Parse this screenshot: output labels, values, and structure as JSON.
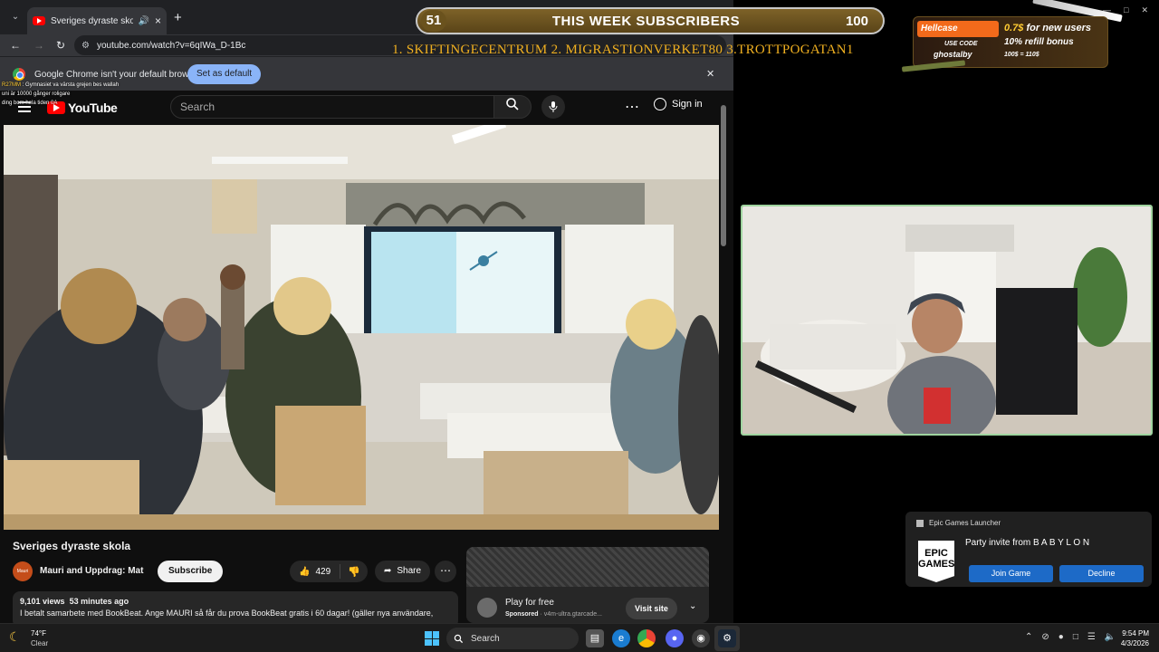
{
  "browser": {
    "tab_title": "Sveriges dyraste skola - YouTube",
    "url": "youtube.com/watch?v=6qIWa_D-1Bc",
    "infobar_message": "Google Chrome isn't your default browser",
    "set_default_label": "Set as default"
  },
  "chat": [
    {
      "user": "R27MM",
      "msg": "Gymnasiet va värsta grejen bes wallah"
    },
    {
      "user": "",
      "msg": "uni är 10000 gånger roligare"
    },
    {
      "user": "",
      "msg": "ding bom hela tiden 0A"
    }
  ],
  "youtube": {
    "logo_text": "YouTube",
    "search_placeholder": "Search",
    "sign_in_label": "Sign in",
    "video_title": "Sveriges dyraste skola",
    "channel_name": "Mauri and Uppdrag: Mat",
    "channel_avatar_text": "Mauri",
    "subscribe_label": "Subscribe",
    "likes": "429",
    "share_label": "Share",
    "views": "9,101 views",
    "age": "53 minutes ago",
    "description": "I betalt samarbete med BookBeat. Ange MAURI så får du prova BookBeat gratis i 60 dagar! (gäller nya användare,",
    "ad_title": "Play for free",
    "ad_sponsored": "Sponsored",
    "ad_domain": "· v4m-ultra.gtarcade...",
    "ad_button": "Visit site"
  },
  "stream_overlay": {
    "sub_count": "51",
    "sub_title": "THIS WEEK SUBSCRIBERS",
    "sub_goal": "100",
    "top_subs": "1. SKIFTINGECENTRUM  2. MIGRASTIONVERKET80 3.TROTTPOGATAN1"
  },
  "hellcase": {
    "brand": "Hellcase",
    "use_code_label": "USE CODE",
    "code": "ghostalby",
    "promo1_amount": "0.7$",
    "promo1_text": "for new users",
    "promo2": "10% refill bonus",
    "promo3": "100$ = 110$"
  },
  "notification": {
    "app": "Epic Games Launcher",
    "logo_text": "EPIC GAMES",
    "message": "Party invite from B A B Y L O N",
    "join_label": "Join Game",
    "decline_label": "Decline"
  },
  "taskbar": {
    "temperature": "74°F",
    "condition": "Clear",
    "search_label": "Search",
    "time": "9:54 PM",
    "date": "4/3/2026"
  }
}
